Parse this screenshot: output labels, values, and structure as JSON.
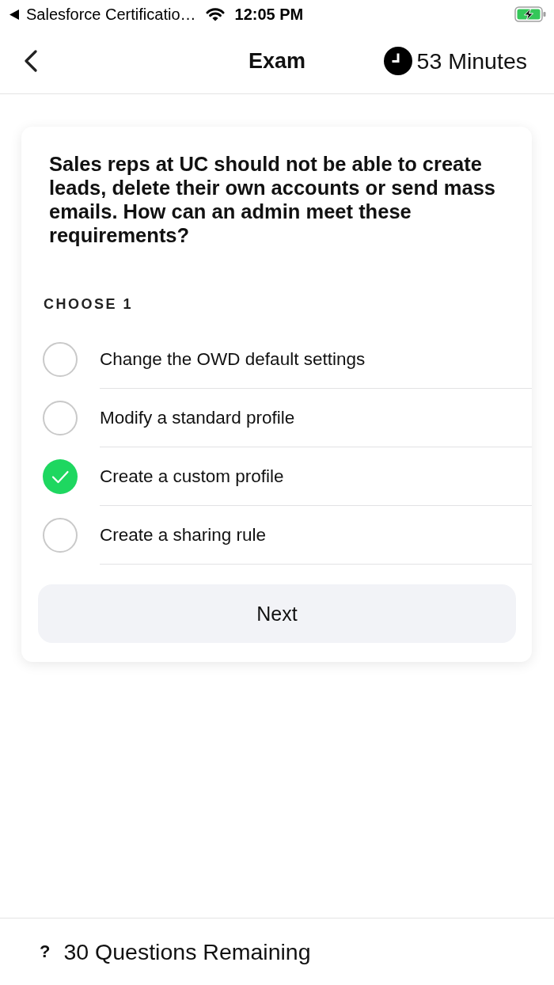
{
  "status_bar": {
    "back_app": "Salesforce Certificatio…",
    "time": "12:05 PM"
  },
  "nav": {
    "title": "Exam",
    "timer": "53 Minutes"
  },
  "question": {
    "text": "Sales reps at UC should not be able to create leads, delete their own accounts or send mass emails. How can an admin meet these requirements?",
    "instruction": "CHOOSE 1",
    "options": [
      {
        "label": "Change the OWD default settings",
        "selected": false
      },
      {
        "label": "Modify a standard profile",
        "selected": false
      },
      {
        "label": "Create a custom profile",
        "selected": true
      },
      {
        "label": "Create a sharing rule",
        "selected": false
      }
    ],
    "button": "Next"
  },
  "footer": {
    "icon": "?",
    "text": "30 Questions Remaining"
  }
}
